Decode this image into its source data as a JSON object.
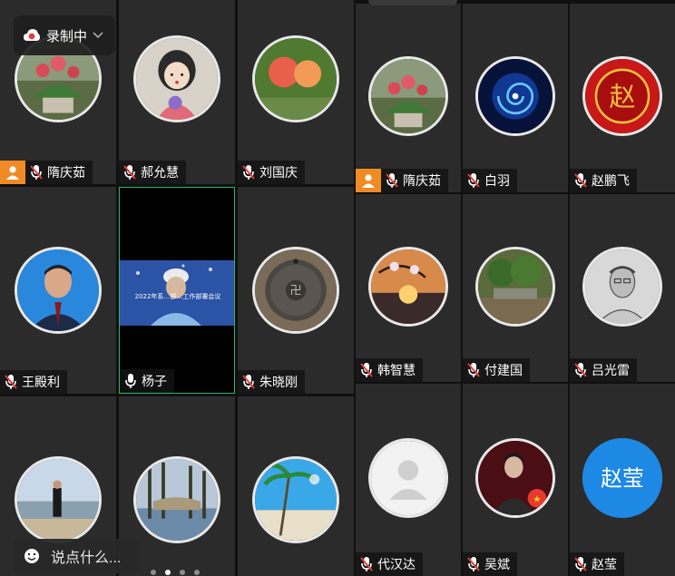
{
  "recording": {
    "label": "录制中"
  },
  "comment": {
    "placeholder": "说点什么..."
  },
  "pagination": {
    "pages": 4,
    "current": 2
  },
  "left_panel": {
    "tiles": [
      {
        "name": "隋庆茹",
        "host": true,
        "mic": "muted"
      },
      {
        "name": "郝允慧",
        "host": false,
        "mic": "muted"
      },
      {
        "name": "刘国庆",
        "host": false,
        "mic": "muted"
      },
      {
        "name": "王殿利",
        "host": false,
        "mic": "muted"
      },
      {
        "name": "杨子",
        "host": false,
        "mic": "on",
        "video_caption": "2022年系…部…工作部署会议"
      },
      {
        "name": "朱晓刚",
        "host": false,
        "mic": "muted"
      },
      {
        "name": "",
        "host": false,
        "mic": "none"
      },
      {
        "name": "",
        "host": false,
        "mic": "none"
      },
      {
        "name": "",
        "host": false,
        "mic": "none"
      }
    ]
  },
  "right_panel": {
    "tiles": [
      {
        "name": "隋庆茹",
        "host": true,
        "mic": "muted"
      },
      {
        "name": "白羽",
        "host": false,
        "mic": "muted"
      },
      {
        "name": "赵鹏飞",
        "host": false,
        "mic": "muted",
        "avatar_text": "赵"
      },
      {
        "name": "韩智慧",
        "host": false,
        "mic": "muted"
      },
      {
        "name": "付建国",
        "host": false,
        "mic": "muted"
      },
      {
        "name": "吕光雷",
        "host": false,
        "mic": "muted"
      },
      {
        "name": "代汉达",
        "host": false,
        "mic": "muted"
      },
      {
        "name": "吴斌",
        "host": false,
        "mic": "muted"
      },
      {
        "name": "赵莹",
        "host": false,
        "mic": "muted",
        "avatar_text": "赵莹"
      }
    ]
  },
  "colors": {
    "host_badge": "#f08a24",
    "mic_muted": "#e04040",
    "active_border": "#2fb36b",
    "avatar_blue": "#1e88e5",
    "tile_bg": "#2b2b2b"
  },
  "icons": {
    "recording": "red-cloud-recording-icon",
    "comment": "smiley-icon",
    "mic_muted": "mic-muted-icon",
    "mic_on": "mic-icon",
    "host": "person-icon"
  }
}
